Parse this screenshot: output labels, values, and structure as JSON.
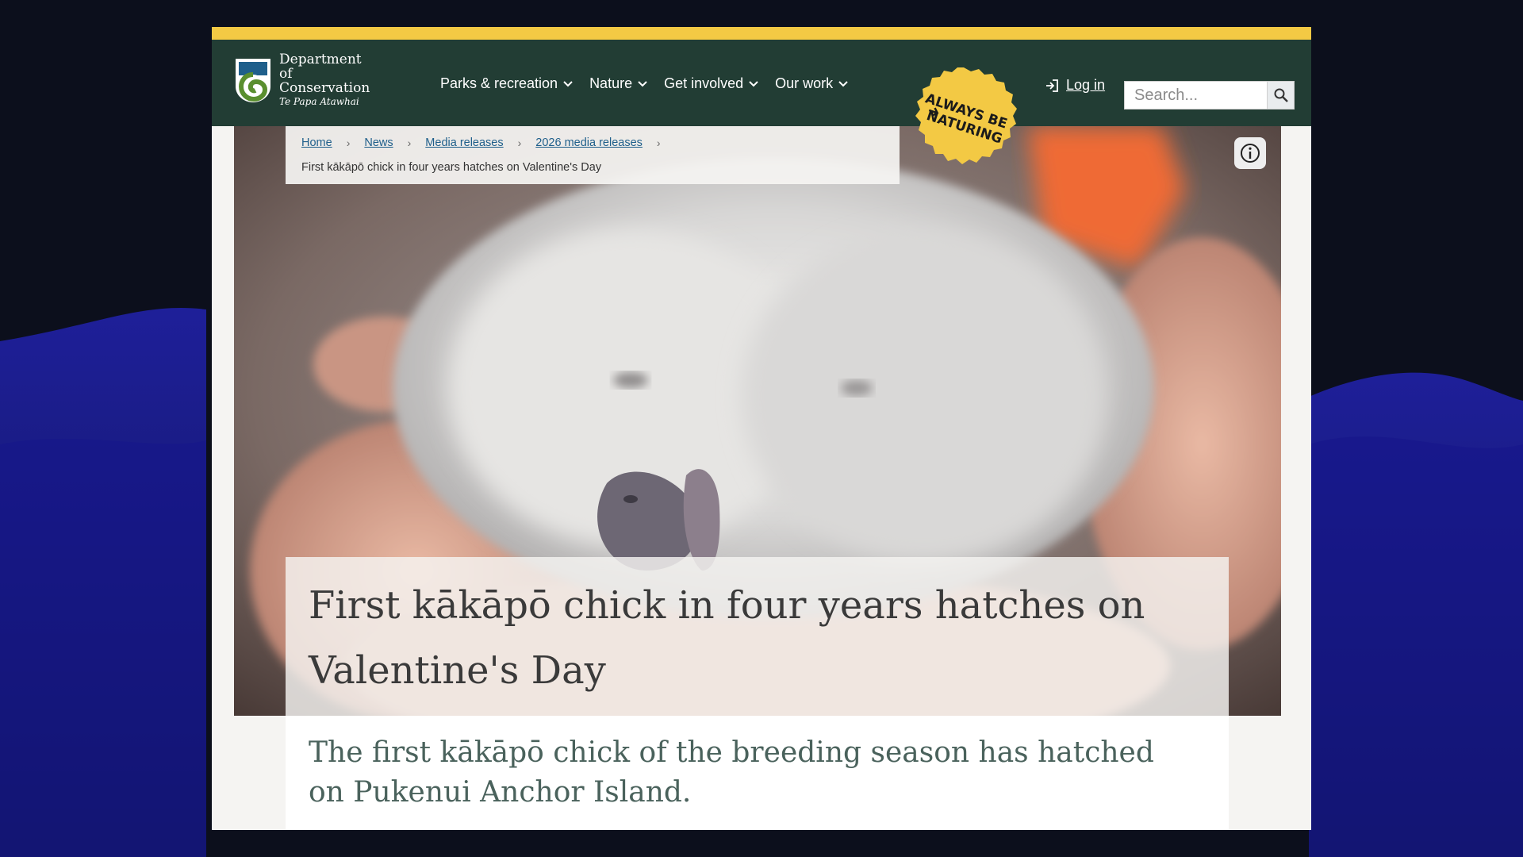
{
  "site": {
    "logo": {
      "line1": "Department of",
      "line2": "Conservation",
      "line3": "Te Papa Atawhai"
    },
    "nav": [
      {
        "label": "Parks & recreation"
      },
      {
        "label": "Nature"
      },
      {
        "label": "Get involved"
      },
      {
        "label": "Our work"
      }
    ],
    "badge_text": [
      "ALWAYS BE",
      "NATURING"
    ],
    "login_label": "Log in",
    "search": {
      "placeholder": "Search..."
    }
  },
  "breadcrumb": {
    "items": [
      "Home",
      "News",
      "Media releases",
      "2026 media releases"
    ],
    "current": "First kākāpō chick in four years hatches on Valentine's Day"
  },
  "article": {
    "title": "First kākāpō chick in four years hatches on Valentine's Day",
    "lead": "The first kākāpō chick of the breeding season has hatched on Pukenui Anchor Island."
  },
  "colors": {
    "accent_stripe": "#f3c944",
    "header_bg": "#223d34",
    "badge": "#f3c944",
    "page_bg": "#0c0f1c",
    "wave": "#1c1d8c"
  },
  "icons": {
    "nav_dropdown": "chevron-down-icon",
    "login": "login-icon",
    "search": "search-icon",
    "info": "info-icon",
    "breadcrumb_separator": "chevron-right-icon"
  }
}
